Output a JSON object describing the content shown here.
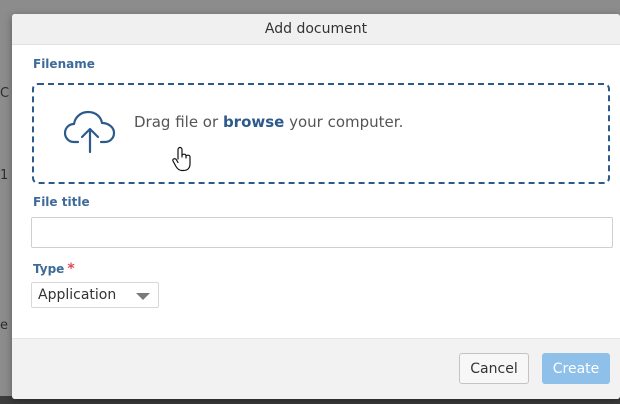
{
  "background": {
    "glyphs": [
      "C",
      "1",
      "e"
    ]
  },
  "dialog": {
    "title": "Add document",
    "filename_label": "Filename",
    "dropzone": {
      "text_before": "Drag file or ",
      "link_text": "browse",
      "text_after": " your computer.",
      "icon": "cloud-upload-icon"
    },
    "file_title_label": "File title",
    "file_title_value": "",
    "type_label": "Type",
    "type_required_mark": "*",
    "type_value": "Application",
    "buttons": {
      "cancel": "Cancel",
      "create": "Create"
    }
  },
  "colors": {
    "label": "#3d6a99",
    "dropzone_border": "#2c5a8c",
    "required": "#e0475a",
    "create_button": "#8ec0ea"
  }
}
